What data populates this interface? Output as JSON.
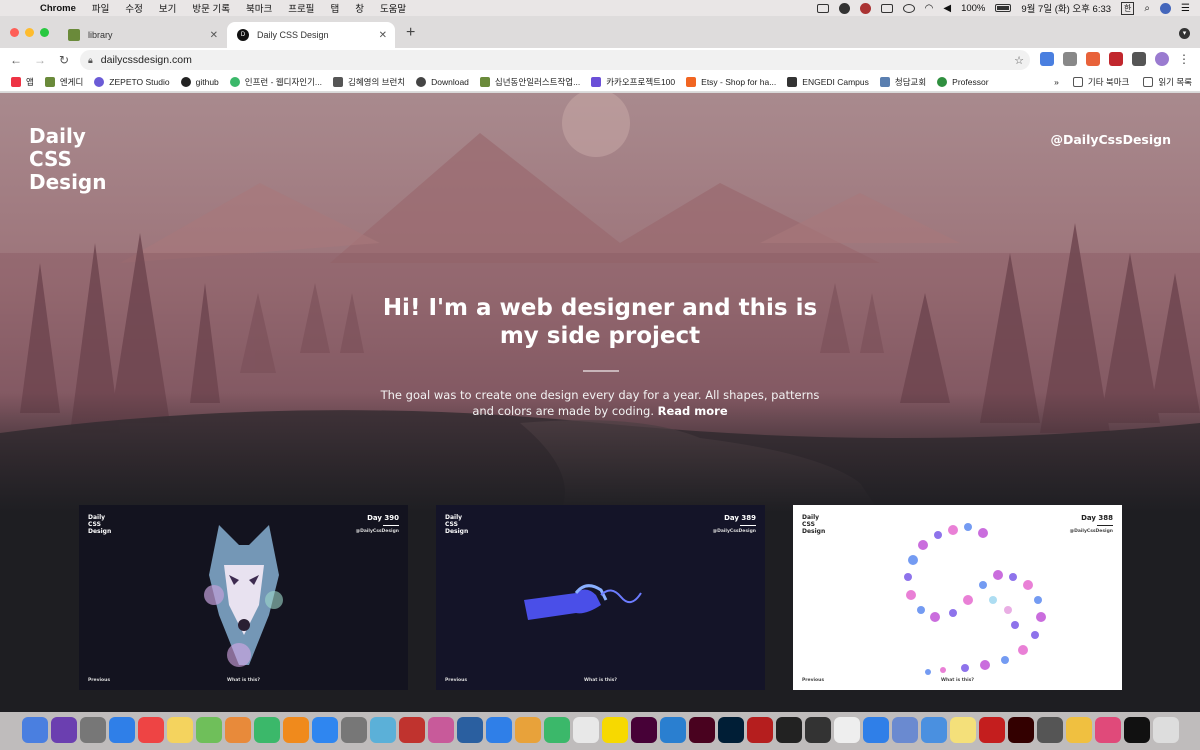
{
  "menubar": {
    "app_name": "Chrome",
    "items": [
      "파일",
      "수정",
      "보기",
      "방문 기록",
      "북마크",
      "프로필",
      "탭",
      "창",
      "도움말"
    ],
    "battery": "100%",
    "datetime": "9월 7일 (화) 오후 6:33",
    "input_method": "한"
  },
  "tabs": [
    {
      "title": "library",
      "active": false
    },
    {
      "title": "Daily CSS Design",
      "active": true
    }
  ],
  "toolbar": {
    "url": "dailycssdesign.com"
  },
  "bookmarks": {
    "items": [
      "앱",
      "엔게디",
      "ZEPETO Studio",
      "github",
      "인프런 - 웹디자인기...",
      "김혜영의 브런치",
      "Download",
      "십년동안일러스트작업...",
      "카카오프로젝트100",
      "Etsy - Shop for ha...",
      "ENGEDI Campus",
      "청담교회",
      "Professor"
    ],
    "overflow": "»",
    "other": "기타 북마크",
    "reading_list": "읽기 목록"
  },
  "page": {
    "logo_lines": [
      "Daily",
      "CSS",
      "Design"
    ],
    "handle": "@DailyCssDesign",
    "headline_line1": "Hi! I'm a web designer and this is",
    "headline_line2": "my side project",
    "subtext": "The goal was to create one design every day for a year. All shapes, patterns and colors are made by coding.",
    "read_more": "Read more",
    "cards": [
      {
        "day": "Day 390",
        "theme": "dark",
        "subject": "wolf"
      },
      {
        "day": "Day 389",
        "theme": "dark",
        "subject": "ribbon"
      },
      {
        "day": "Day 388",
        "theme": "light",
        "subject": "dots"
      }
    ],
    "card_logo_lines": [
      "Daily",
      "CSS",
      "Design"
    ],
    "card_handle": "@DailyCssDesign",
    "card_prev": "Previous",
    "card_what": "What is this?"
  },
  "colors": {
    "hero_top": "#a7868b",
    "hero_mid": "#8c5f68",
    "dark_bg": "#1e1e22",
    "card_dark": "#14142a",
    "card_light": "#ffffff"
  },
  "dock": {
    "icons": [
      "finder-icon",
      "siri-icon",
      "launchpad-icon",
      "safari-icon",
      "calendar-icon",
      "notes-icon",
      "maps-icon",
      "photos-icon",
      "facetime-icon",
      "books-icon",
      "app-store-icon",
      "system-preferences-icon",
      "sourcetree-icon",
      "mindnode-icon",
      "preview-icon",
      "quicktime-icon",
      "keynote-icon",
      "pages-icon",
      "numbers-icon",
      "chrome-icon",
      "kakaotalk-icon",
      "xd-icon",
      "vscode-icon",
      "indesign-icon",
      "photoshop-icon",
      "filezilla-icon",
      "unity-icon",
      "unity-hub-icon",
      "textedit-icon",
      "xcode-icon",
      "folder-icon",
      "finder-alt-icon",
      "stickies-icon",
      "acrobat-icon",
      "illustrator-icon",
      "files-icon",
      "notes-alt-icon",
      "slack-icon",
      "terminal-icon",
      "trash-icon"
    ]
  }
}
